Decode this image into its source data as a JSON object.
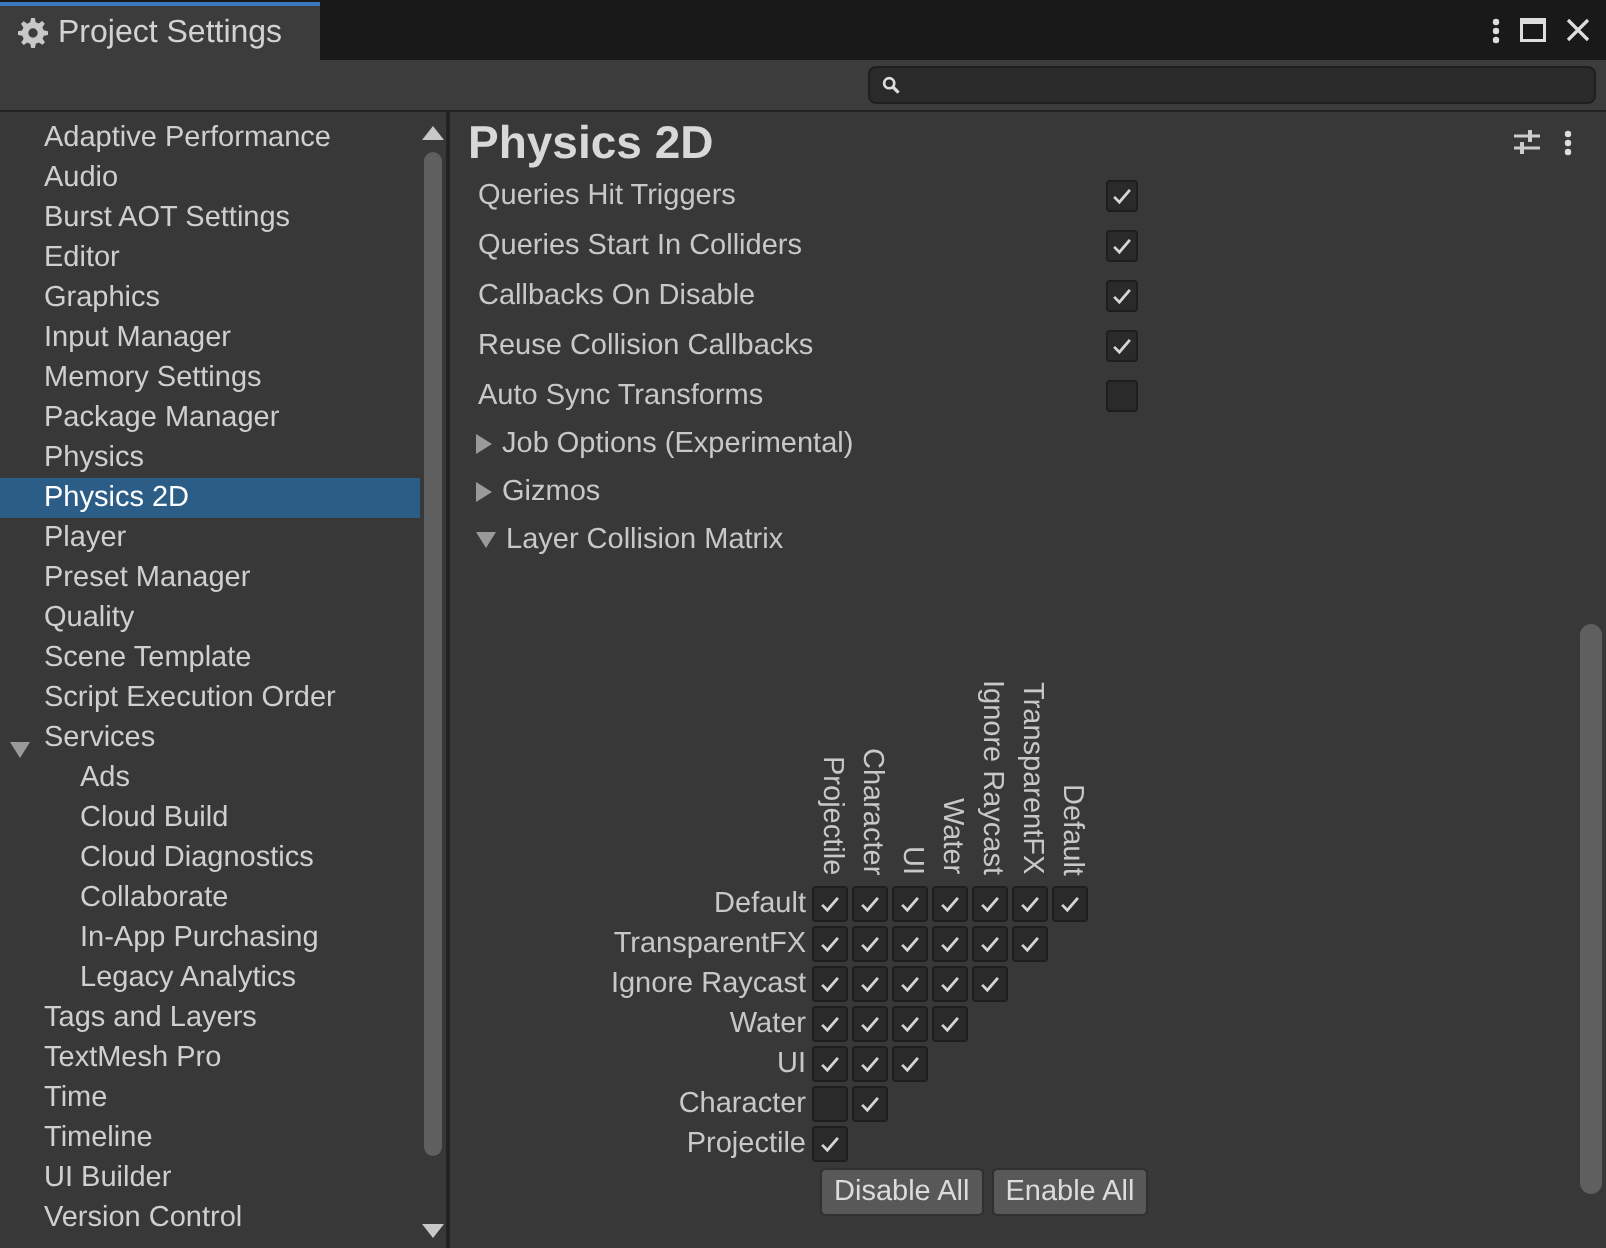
{
  "window": {
    "title": "Project Settings"
  },
  "sidebar": {
    "items": [
      {
        "label": "Adaptive Performance",
        "selected": false
      },
      {
        "label": "Audio",
        "selected": false
      },
      {
        "label": "Burst AOT Settings",
        "selected": false
      },
      {
        "label": "Editor",
        "selected": false
      },
      {
        "label": "Graphics",
        "selected": false
      },
      {
        "label": "Input Manager",
        "selected": false
      },
      {
        "label": "Memory Settings",
        "selected": false
      },
      {
        "label": "Package Manager",
        "selected": false
      },
      {
        "label": "Physics",
        "selected": false
      },
      {
        "label": "Physics 2D",
        "selected": true
      },
      {
        "label": "Player",
        "selected": false
      },
      {
        "label": "Preset Manager",
        "selected": false
      },
      {
        "label": "Quality",
        "selected": false
      },
      {
        "label": "Scene Template",
        "selected": false
      },
      {
        "label": "Script Execution Order",
        "selected": false
      },
      {
        "label": "Services",
        "selected": false,
        "expanded": true,
        "children": [
          {
            "label": "Ads",
            "selected": false
          },
          {
            "label": "Cloud Build",
            "selected": false
          },
          {
            "label": "Cloud Diagnostics",
            "selected": false
          },
          {
            "label": "Collaborate",
            "selected": false
          },
          {
            "label": "In-App Purchasing",
            "selected": false
          },
          {
            "label": "Legacy Analytics",
            "selected": false
          }
        ]
      },
      {
        "label": "Tags and Layers",
        "selected": false
      },
      {
        "label": "TextMesh Pro",
        "selected": false
      },
      {
        "label": "Time",
        "selected": false
      },
      {
        "label": "Timeline",
        "selected": false
      },
      {
        "label": "UI Builder",
        "selected": false
      },
      {
        "label": "Version Control",
        "selected": false
      }
    ]
  },
  "inspector": {
    "title": "Physics 2D",
    "properties": [
      {
        "kind": "checkbox",
        "label": "Queries Hit Triggers",
        "checked": true
      },
      {
        "kind": "checkbox",
        "label": "Queries Start In Colliders",
        "checked": true
      },
      {
        "kind": "checkbox",
        "label": "Callbacks On Disable",
        "checked": true
      },
      {
        "kind": "checkbox",
        "label": "Reuse Collision Callbacks",
        "checked": true
      },
      {
        "kind": "checkbox",
        "label": "Auto Sync Transforms",
        "checked": false
      },
      {
        "kind": "foldout",
        "label": "Job Options (Experimental)",
        "expanded": false
      },
      {
        "kind": "foldout",
        "label": "Gizmos",
        "expanded": false
      },
      {
        "kind": "foldout",
        "label": "Layer Collision Matrix",
        "expanded": true,
        "matrix": {
          "columns": [
            "Projectile",
            "Character",
            "UI",
            "Water",
            "Ignore Raycast",
            "TransparentFX",
            "Default"
          ],
          "rows": [
            {
              "label": "Default",
              "checked": [
                true,
                true,
                true,
                true,
                true,
                true,
                true
              ]
            },
            {
              "label": "TransparentFX",
              "checked": [
                true,
                true,
                true,
                true,
                true,
                true
              ]
            },
            {
              "label": "Ignore Raycast",
              "checked": [
                true,
                true,
                true,
                true,
                true
              ]
            },
            {
              "label": "Water",
              "checked": [
                true,
                true,
                true,
                true
              ]
            },
            {
              "label": "UI",
              "checked": [
                true,
                true,
                true
              ]
            },
            {
              "label": "Character",
              "checked": [
                false,
                true
              ]
            },
            {
              "label": "Projectile",
              "checked": [
                true
              ]
            }
          ],
          "buttons": [
            "Disable All",
            "Enable All"
          ]
        }
      }
    ]
  }
}
